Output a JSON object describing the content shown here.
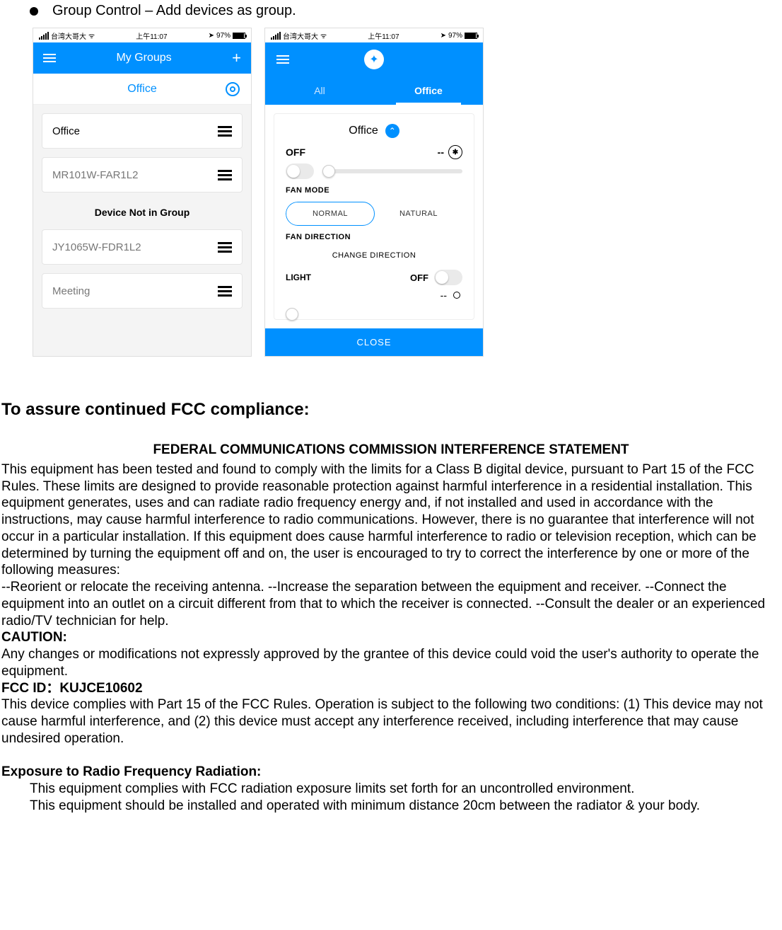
{
  "bullet_title": "Group Control – Add devices as group.",
  "status": {
    "carrier": "台湾大哥大",
    "time": "上午11:07",
    "battery": "97%"
  },
  "phone_left": {
    "header_title": "My Groups",
    "active_group": "Office",
    "devices_in_group": [
      {
        "name": "Office"
      },
      {
        "name": "MR101W-FAR1L2"
      }
    ],
    "section_label": "Device Not in Group",
    "devices_not_in_group": [
      {
        "name": "JY1065W-FDR1L2"
      },
      {
        "name": "Meeting"
      }
    ]
  },
  "phone_right": {
    "tabs": {
      "all": "All",
      "office": "Office"
    },
    "panel_title": "Office",
    "off_label": "OFF",
    "off_value": "--",
    "fan_mode_label": "FAN MODE",
    "fan_mode_normal": "NORMAL",
    "fan_mode_natural": "NATURAL",
    "fan_dir_label": "FAN DIRECTION",
    "change_dir": "CHANGE DIRECTION",
    "light_label": "LIGHT",
    "light_state": "OFF",
    "light_value": "--",
    "close": "CLOSE"
  },
  "doc": {
    "h2": "To assure continued FCC compliance:",
    "fed_title": "FEDERAL COMMUNICATIONS COMMISSION INTERFERENCE STATEMENT",
    "p1": "This equipment has been tested and found to comply with the limits for a Class B digital device, pursuant to Part 15 of the FCC Rules. These limits are designed to provide reasonable protection against harmful interference in a residential installation. This equipment generates, uses and can radiate radio frequency energy and, if not installed and used in accordance with the instructions, may cause harmful interference to radio communications. However, there is no guarantee that interference will not occur in a particular installation. If this equipment does cause harmful interference to radio or television reception, which can be determined by turning the equipment off and on, the user is encouraged to try to correct the interference by one or more of the following measures:",
    "p2": "--Reorient or relocate the receiving antenna. --Increase the separation between the equipment and receiver. --Connect the equipment into an outlet on a circuit different from that to which the receiver is connected. --Consult the dealer or an experienced radio/TV technician for help.",
    "caution_label": "CAUTION:",
    "caution_text": "Any changes or modifications not expressly approved by the grantee of this device could void the user's authority to operate the equipment.",
    "fccid_label": "FCC ID：KUJCE10602",
    "p3": "This device complies with Part 15 of the FCC Rules. Operation is subject to the following two conditions: (1) This device may not cause harmful interference, and (2) this device must accept any interference received, including interference that may cause undesired operation.",
    "rf_label": "Exposure to Radio Frequency Radiation:",
    "rf1": "This equipment complies with FCC radiation exposure limits set forth for an uncontrolled environment.",
    "rf2": "This equipment should be installed and operated with minimum distance 20cm between the radiator & your body."
  }
}
